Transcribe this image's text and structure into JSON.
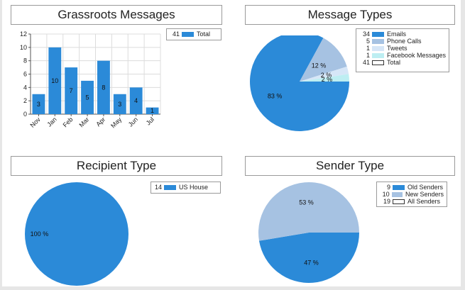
{
  "charts": [
    {
      "id": "grassroots",
      "title": "Grassroots Messages",
      "chart_data": {
        "type": "bar",
        "title": "Grassroots Messages",
        "categories": [
          "Nov",
          "Jan",
          "Feb",
          "Mar",
          "Apr",
          "May",
          "Jun",
          "Jul"
        ],
        "values": [
          3,
          10,
          7,
          5,
          8,
          3,
          4,
          1
        ],
        "ylim": [
          0,
          12
        ],
        "yticks": [
          "0",
          "2",
          "4",
          "6",
          "8",
          "10",
          "12"
        ],
        "grid": true,
        "legend": [
          {
            "count": "41",
            "label": "Total",
            "color": "#2b8ad8"
          }
        ],
        "bar_color": "#2b8ad8"
      }
    },
    {
      "id": "message-types",
      "title": "Message Types",
      "chart_data": {
        "type": "pie",
        "title": "Message Types",
        "slices": [
          {
            "label": "Emails",
            "count": "34",
            "value": 34,
            "percent_label": "83 %",
            "color": "#2b8ad8"
          },
          {
            "label": "Phone Calls",
            "count": "5",
            "value": 5,
            "percent_label": "12 %",
            "color": "#a6c2e2"
          },
          {
            "label": "Tweets",
            "count": "1",
            "value": 1,
            "percent_label": "2 %",
            "color": "#d6e6f7"
          },
          {
            "label": "Facebook Messages",
            "count": "1",
            "value": 1,
            "percent_label": "2 %",
            "color": "#bdeef2"
          }
        ],
        "total": {
          "label": "Total",
          "count": "41"
        }
      }
    },
    {
      "id": "recipient-type",
      "title": "Recipient Type",
      "chart_data": {
        "type": "pie",
        "title": "Recipient Type",
        "slices": [
          {
            "label": "US House",
            "count": "14",
            "value": 14,
            "percent_label": "100 %",
            "color": "#2b8ad8"
          }
        ]
      }
    },
    {
      "id": "sender-type",
      "title": "Sender Type",
      "chart_data": {
        "type": "pie",
        "title": "Sender Type",
        "slices": [
          {
            "label": "Old Senders",
            "count": "9",
            "value": 9,
            "percent_label": "47 %",
            "color": "#2b8ad8"
          },
          {
            "label": "New Senders",
            "count": "10",
            "value": 10,
            "percent_label": "53 %",
            "color": "#a6c2e2"
          }
        ],
        "total": {
          "label": "All Senders",
          "count": "19"
        }
      }
    }
  ]
}
